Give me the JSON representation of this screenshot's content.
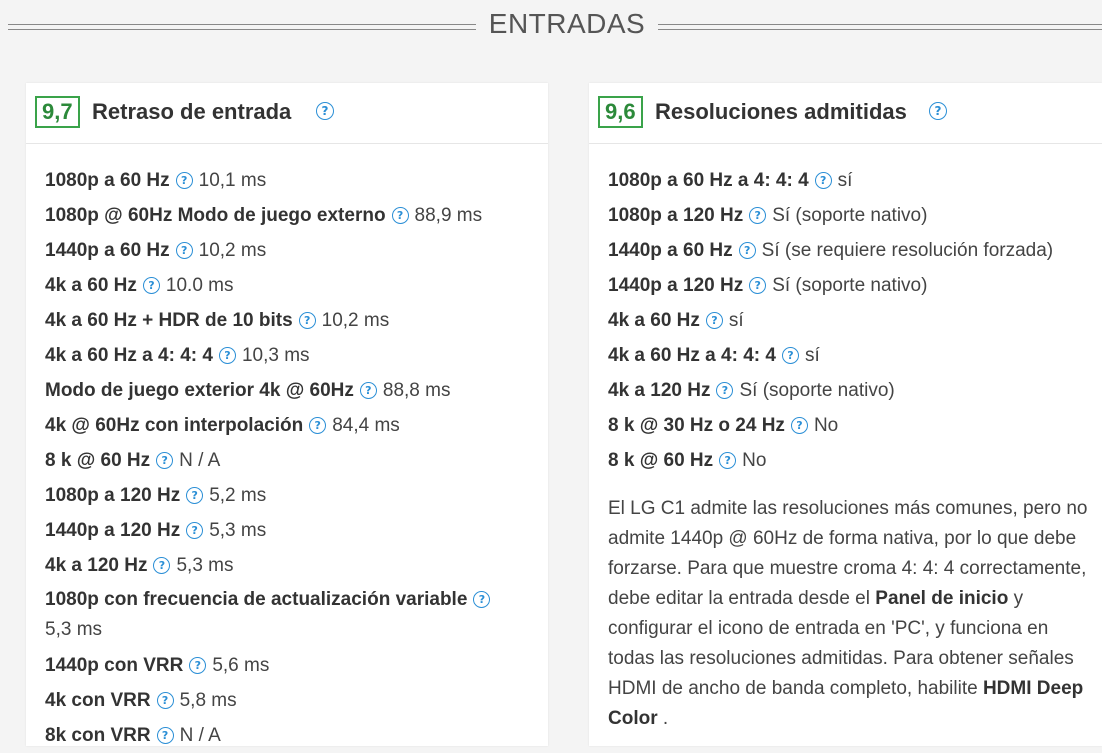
{
  "section": {
    "title": "ENTRADAS"
  },
  "left_card": {
    "score": "9,7",
    "title": "Retraso de entrada",
    "rows": [
      {
        "label": "1080p a 60 Hz",
        "value": "10,1 ms"
      },
      {
        "label": "1080p @ 60Hz Modo de juego externo",
        "value": "88,9 ms"
      },
      {
        "label": "1440p a 60 Hz",
        "value": "10,2 ms"
      },
      {
        "label": "4k a 60 Hz",
        "value": "10.0 ms"
      },
      {
        "label": "4k a 60 Hz + HDR de 10 bits",
        "value": "10,2 ms"
      },
      {
        "label": "4k a 60 Hz a 4: 4: 4",
        "value": "10,3 ms"
      },
      {
        "label": "Modo de juego exterior 4k @ 60Hz",
        "value": "88,8 ms"
      },
      {
        "label": "4k @ 60Hz con interpolación",
        "value": "84,4 ms"
      },
      {
        "label": "8 k @ 60 Hz",
        "value": "N / A"
      },
      {
        "label": "1080p a 120 Hz",
        "value": "5,2 ms"
      },
      {
        "label": "1440p a 120 Hz",
        "value": "5,3 ms"
      },
      {
        "label": "4k a 120 Hz",
        "value": "5,3 ms"
      },
      {
        "label": "1080p con frecuencia de actualización variable",
        "value": "5,3 ms"
      },
      {
        "label": "1440p con VRR",
        "value": "5,6 ms"
      },
      {
        "label": "4k con VRR",
        "value": "5,8 ms"
      },
      {
        "label": "8k con VRR",
        "value": "N / A"
      }
    ]
  },
  "right_card": {
    "score": "9,6",
    "title": "Resoluciones admitidas",
    "rows": [
      {
        "label": "1080p a 60 Hz a 4: 4: 4",
        "value": "sí"
      },
      {
        "label": "1080p a 120 Hz",
        "value": "Sí (soporte nativo)"
      },
      {
        "label": "1440p a 60 Hz",
        "value": "Sí (se requiere resolución forzada)"
      },
      {
        "label": "1440p a 120 Hz",
        "value": "Sí (soporte nativo)"
      },
      {
        "label": "4k a 60 Hz",
        "value": "sí"
      },
      {
        "label": "4k a 60 Hz a 4: 4: 4",
        "value": "sí"
      },
      {
        "label": "4k a 120 Hz",
        "value": "Sí (soporte nativo)"
      },
      {
        "label": "8 k @ 30 Hz o 24 Hz",
        "value": "No"
      },
      {
        "label": "8 k @ 60 Hz",
        "value": "No"
      }
    ],
    "description": {
      "part1": "El LG C1 admite las resoluciones más comunes, pero no admite 1440p @ 60Hz de forma nativa, por lo que debe forzarse. Para que muestre croma 4: 4: 4 correctamente, debe editar la entrada desde el ",
      "bold1": "Panel de inicio",
      "part2": " y configurar el icono de entrada en 'PC', y funciona en todas las resoluciones admitidas. Para obtener señales HDMI de ancho de banda completo, habilite ",
      "bold2": "HDMI Deep Color",
      "part3": " ."
    }
  },
  "icons": {
    "help": "?"
  },
  "colors": {
    "score_border": "#3aa34a",
    "help_icon": "#2b8fd6"
  }
}
